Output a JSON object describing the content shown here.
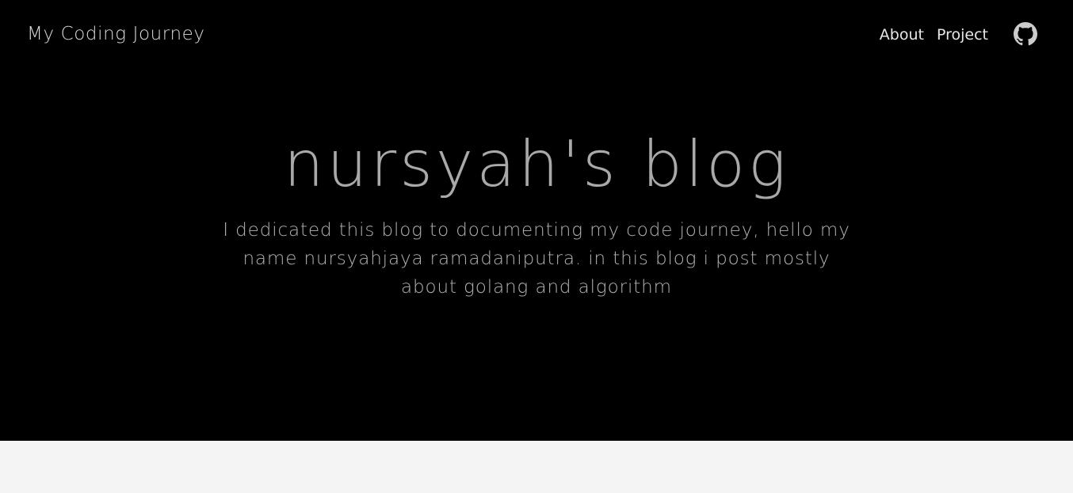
{
  "navbar": {
    "brand": "My Coding Journey",
    "links": [
      {
        "label": "About"
      },
      {
        "label": "Project"
      }
    ],
    "github_icon": "github-icon"
  },
  "hero": {
    "title": "nursyah's blog",
    "subtitle": "I dedicated this blog to documenting my code journey, hello my name nursyahjaya ramadaniputra. in this blog i post mostly about golang and algorithm"
  },
  "colors": {
    "hero_background": "#000000",
    "page_background": "#f4f4f4",
    "title_text": "#a9a9a9",
    "nav_text": "#e6e6e6"
  }
}
